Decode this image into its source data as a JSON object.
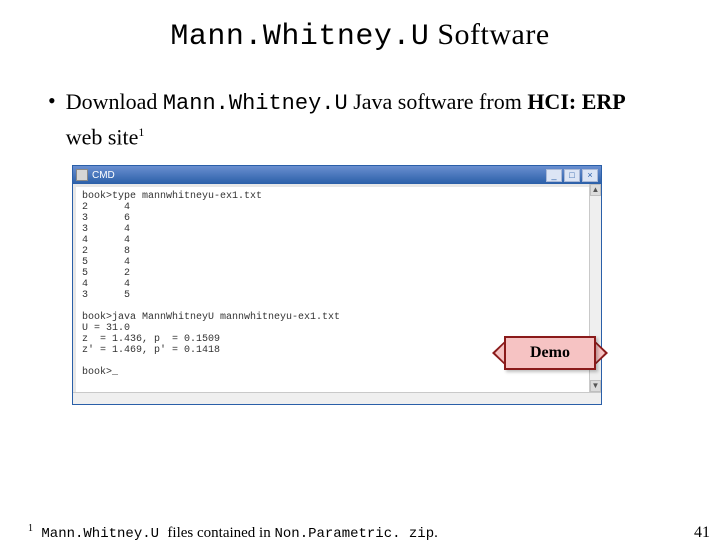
{
  "title": {
    "mono": "Mann.Whitney.U",
    "rest": " Software"
  },
  "bullet": {
    "lead": "Download ",
    "mono": "Mann.Whitney.U",
    "mid": " Java software from ",
    "bold": "HCI: ERP",
    "tail": " web site",
    "sup": "1"
  },
  "window": {
    "title": "CMD",
    "buttons": {
      "min": "_",
      "max": "□",
      "close": "×"
    }
  },
  "terminal_text": "book>type mannwhitneyu-ex1.txt\n2      4\n3      6\n3      4\n4      4\n2      8\n5      4\n5      2\n4      4\n3      5\n\nbook>java MannWhitneyU mannwhitneyu-ex1.txt\nU = 31.0\nz  = 1.436, p  = 0.1509\nz' = 1.469, p' = 0.1418\n\nbook>_",
  "demo_label": "Demo",
  "footnote": {
    "sup": "1",
    "mono1": " Mann.Whitney.U ",
    "mid": "files contained in ",
    "mono2": "Non.Parametric. zip",
    "end": "."
  },
  "page_number": "41"
}
